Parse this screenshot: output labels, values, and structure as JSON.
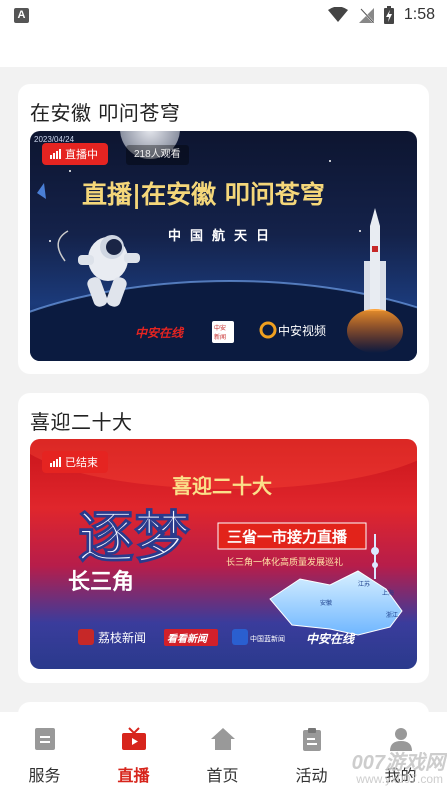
{
  "status": {
    "notification_icon": "A",
    "time": "1:58"
  },
  "cards": [
    {
      "title": "在安徽 叩问苍穹",
      "badge": "直播中",
      "viewers": "218人观看",
      "date": "2023/04/24",
      "banner_headline": "直播|在安徽 叩问苍穹",
      "banner_sub": "中国航天日",
      "logos": [
        "中安在线",
        "中安新闻",
        "中安视频"
      ]
    },
    {
      "title": "喜迎二十大",
      "badge": "已结束",
      "banner_headline": "喜迎二十大",
      "big_text": "逐梦",
      "side_text": "长三角",
      "relay_title": "三省一市接力直播",
      "relay_sub": "长三角一体化高质量发展巡礼",
      "map_labels": [
        "江苏",
        "上海",
        "安徽",
        "浙江"
      ],
      "logos": [
        "荔枝新闻",
        "看看新闻",
        "中国蓝新闻",
        "中安在线"
      ]
    }
  ],
  "tabs": [
    {
      "label": "服务",
      "icon": "document-icon"
    },
    {
      "label": "直播",
      "icon": "tv-icon"
    },
    {
      "label": "首页",
      "icon": "home-icon"
    },
    {
      "label": "活动",
      "icon": "clipboard-icon"
    },
    {
      "label": "我的",
      "icon": "user-icon"
    }
  ],
  "watermark": {
    "text": "007游戏网",
    "url": "www.yx007.com"
  },
  "colors": {
    "accent": "#d7251c",
    "badge": "#e52421"
  }
}
